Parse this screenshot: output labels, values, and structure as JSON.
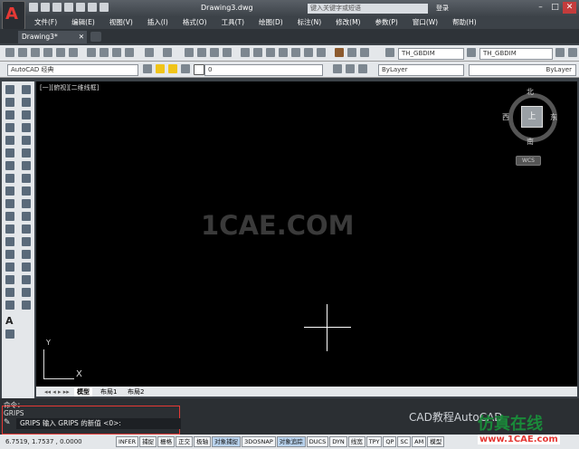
{
  "titlebar": {
    "doc_title": "Drawing3.dwg",
    "search_placeholder": "键入关键字或短语",
    "login_label": "登录",
    "minimize": "–",
    "restore": "□",
    "close": "✕"
  },
  "menubar": {
    "items": [
      "文件(F)",
      "编辑(E)",
      "视图(V)",
      "插入(I)",
      "格式(O)",
      "工具(T)",
      "绘图(D)",
      "标注(N)",
      "修改(M)",
      "参数(P)",
      "窗口(W)",
      "帮助(H)"
    ]
  },
  "doc_tabs": {
    "active": "Drawing3*",
    "close": "✕"
  },
  "toolbars": {
    "workspace": "AutoCAD 经典",
    "layer": "0",
    "dimstyle1": "TH_GBDIM",
    "dimstyle2": "TH_GBDIM",
    "color": "ByLayer",
    "linetype": "ByLayer"
  },
  "viewport": {
    "label": "[一][俯视][二维线框]",
    "viewcube_face": "上",
    "north": "北",
    "south": "南",
    "east": "东",
    "west": "西",
    "wcs": "WCS",
    "watermark": "1CAE.COM",
    "ucs_x": "X",
    "ucs_y": "Y"
  },
  "layout_tabs": [
    "模型",
    "布局1",
    "布局2"
  ],
  "command": {
    "history1": "命令：",
    "history2": "GRIPS",
    "prompt": "GRIPS 输入 GRIPS 的新值 <0>:"
  },
  "status": {
    "coords": "6.7519, 1.7537 , 0.0000",
    "buttons": [
      "INFER",
      "捕捉",
      "栅格",
      "正交",
      "极轴",
      "对象捕捉",
      "3DOSNAP",
      "对象追踪",
      "DUCS",
      "DYN",
      "线宽",
      "TPY",
      "QP",
      "SC",
      "AM",
      "模型"
    ]
  },
  "branding": {
    "wechat": "CAD教程AutoCAD",
    "name": "仿真在线",
    "url": "www.1CAE.com"
  },
  "colors": {
    "accent": "#e53935",
    "canvas": "#000000",
    "brand_green": "#1a8a3a"
  }
}
